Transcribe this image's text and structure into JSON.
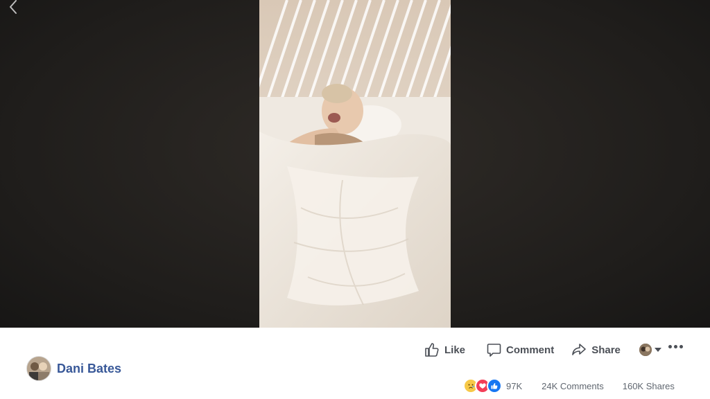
{
  "app": {
    "accent": "#385898",
    "text_muted": "#606770",
    "action_color": "#4b4f56"
  },
  "nav": {
    "back_icon": "chevron-left-icon"
  },
  "post": {
    "author_name": "Dani Bates",
    "avatar_icon": "profile-photo-icon"
  },
  "actions": {
    "like_label": "Like",
    "comment_label": "Comment",
    "share_label": "Share"
  },
  "stats": {
    "reaction_icons": [
      "sad-reaction-icon",
      "love-reaction-icon",
      "like-reaction-icon"
    ],
    "reaction_count": "97K",
    "comments": "24K Comments",
    "shares": "160K Shares"
  }
}
